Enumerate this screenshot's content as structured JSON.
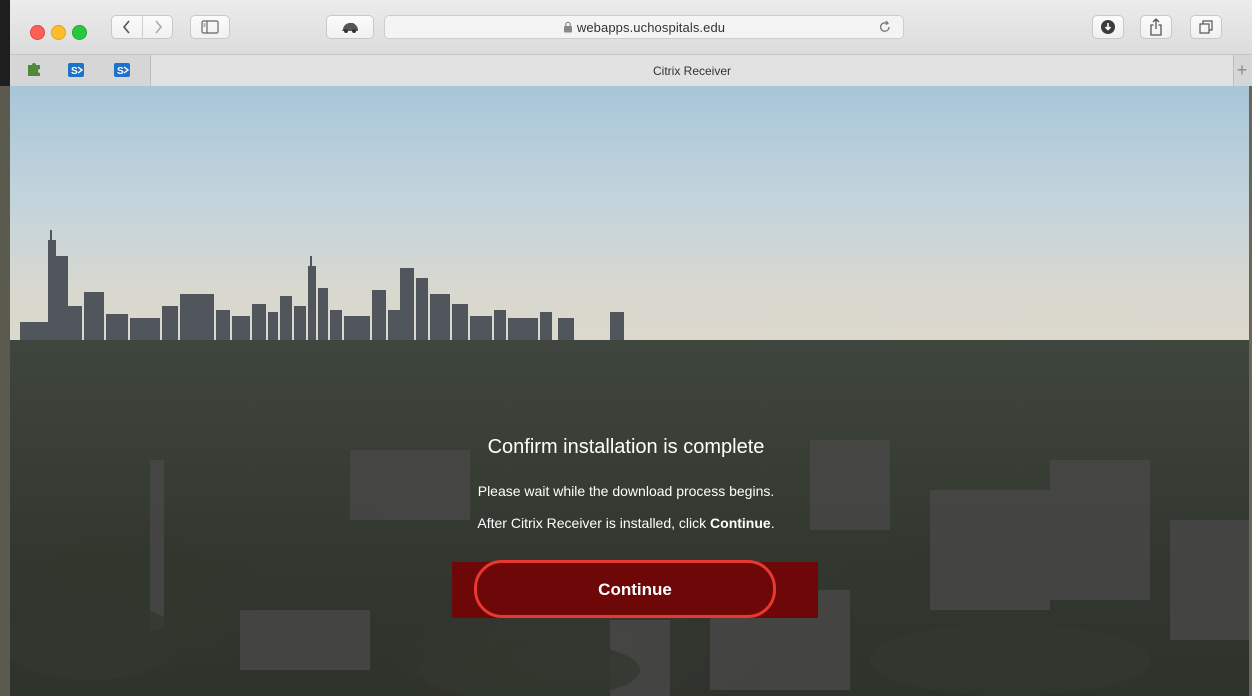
{
  "browser": {
    "address_url": "webapps.uchospitals.edu",
    "tab_title": "Citrix Receiver",
    "new_tab_label": "+"
  },
  "dialog": {
    "title": "Confirm installation is complete",
    "line1": "Please wait while the download process begins.",
    "line2_prefix": "After Citrix Receiver is installed, click ",
    "line2_bold": "Continue",
    "line2_suffix": ".",
    "button_label": "Continue"
  },
  "colors": {
    "button_bg": "#6e0808",
    "highlight_ring": "#e8382f"
  }
}
